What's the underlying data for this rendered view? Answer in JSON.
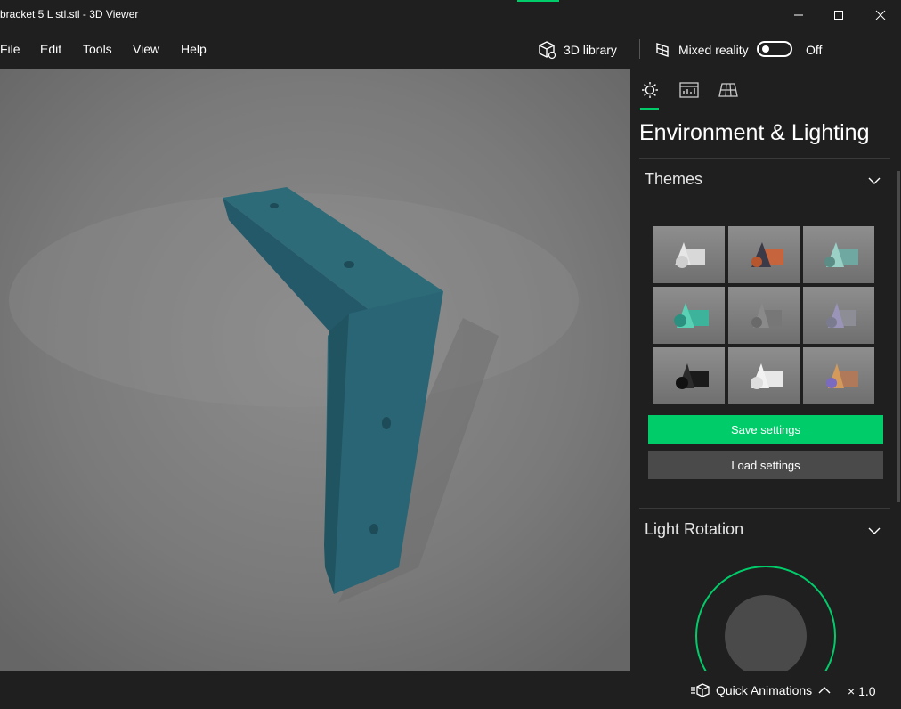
{
  "window": {
    "title": "bracket 5 L stl.stl - 3D Viewer",
    "accent_color": "#00cc6a"
  },
  "menu": {
    "items": [
      "File",
      "Edit",
      "Tools",
      "View",
      "Help"
    ],
    "library_label": "3D library",
    "mixed_reality_label": "Mixed reality",
    "toggle_state": "Off"
  },
  "viewport": {
    "model_color": "#2f6e7d",
    "background_color": "#7b7b7b"
  },
  "panel": {
    "tabs": [
      "sun-icon",
      "stats-icon",
      "grid-icon"
    ],
    "active_tab": 0,
    "title": "Environment & Lighting",
    "themes": {
      "label": "Themes",
      "count": 9,
      "save_label": "Save settings",
      "load_label": "Load settings"
    },
    "light_rotation": {
      "label": "Light Rotation"
    }
  },
  "status": {
    "quick_animations_label": "Quick Animations",
    "speed": "× 1.0"
  },
  "colors": {
    "save_button": "#00cc6a",
    "load_button": "#4a4a4a",
    "background": "#1f1f1f"
  }
}
